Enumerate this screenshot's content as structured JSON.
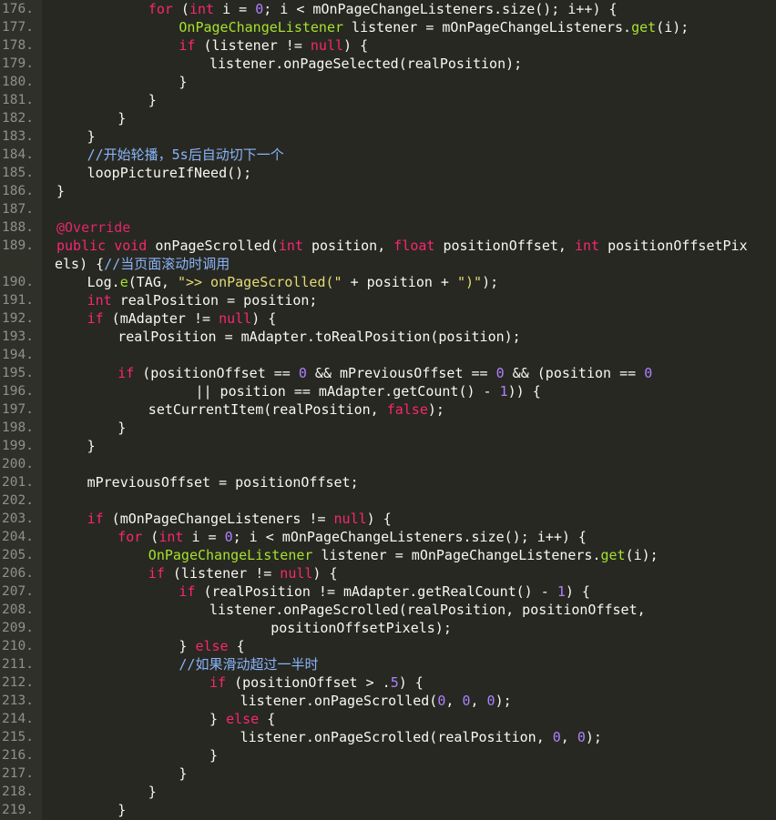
{
  "lines": [
    {
      "no": "176.",
      "ind": 7,
      "tok": [
        [
          "k",
          "for"
        ],
        [
          "p",
          " ("
        ],
        [
          "k",
          "int"
        ],
        [
          "p",
          " i = "
        ],
        [
          "n",
          "0"
        ],
        [
          "p",
          "; i < mOnPageChangeListeners.size(); i++) {"
        ]
      ]
    },
    {
      "no": "177.",
      "ind": 8,
      "tok": [
        [
          "f",
          "OnPageChangeListener"
        ],
        [
          "p",
          " listener = mOnPageChangeListeners."
        ],
        [
          "f",
          "get"
        ],
        [
          "p",
          "(i);"
        ]
      ]
    },
    {
      "no": "178.",
      "ind": 8,
      "tok": [
        [
          "k",
          "if"
        ],
        [
          "p",
          " (listener != "
        ],
        [
          "k",
          "null"
        ],
        [
          "p",
          ") {"
        ]
      ]
    },
    {
      "no": "179.",
      "ind": 9,
      "tok": [
        [
          "p",
          "listener.onPageSelected(realPosition);"
        ]
      ]
    },
    {
      "no": "180.",
      "ind": 8,
      "tok": [
        [
          "p",
          "}"
        ]
      ]
    },
    {
      "no": "181.",
      "ind": 7,
      "tok": [
        [
          "p",
          "}"
        ]
      ]
    },
    {
      "no": "182.",
      "ind": 6,
      "tok": [
        [
          "p",
          "}"
        ]
      ]
    },
    {
      "no": "183.",
      "ind": 5,
      "tok": [
        [
          "p",
          "}"
        ]
      ]
    },
    {
      "no": "184.",
      "ind": 5,
      "tok": [
        [
          "cm",
          "//开始轮播，5s后自动切下一个"
        ]
      ]
    },
    {
      "no": "185.",
      "ind": 5,
      "tok": [
        [
          "p",
          "loopPictureIfNeed();"
        ]
      ]
    },
    {
      "no": "186.",
      "ind": 4,
      "tok": [
        [
          "p",
          "}"
        ]
      ]
    },
    {
      "no": "187.",
      "ind": 0,
      "tok": []
    },
    {
      "no": "188.",
      "ind": 4,
      "tok": [
        [
          "a",
          "@Override"
        ]
      ]
    },
    {
      "no": "189.",
      "ind": 4,
      "tok": [
        [
          "k",
          "public"
        ],
        [
          "p",
          " "
        ],
        [
          "k",
          "void"
        ],
        [
          "p",
          " onPageScrolled("
        ],
        [
          "k",
          "int"
        ],
        [
          "p",
          " position, "
        ],
        [
          "k",
          "float"
        ],
        [
          "p",
          " positionOffset, "
        ],
        [
          "k",
          "int"
        ],
        [
          "p",
          " positionOffsetPix"
        ]
      ]
    },
    {
      "no": "",
      "ind": 0,
      "wrap": true,
      "tok": [
        [
          "p",
          "els) {"
        ],
        [
          "cm",
          "//当页面滚动时调用"
        ]
      ]
    },
    {
      "no": "190.",
      "ind": 5,
      "tok": [
        [
          "p",
          "Log."
        ],
        [
          "f",
          "e"
        ],
        [
          "p",
          "(TAG, "
        ],
        [
          "s",
          "\">> onPageScrolled(\""
        ],
        [
          "p",
          " + position + "
        ],
        [
          "s",
          "\")\""
        ],
        [
          "p",
          ");"
        ]
      ]
    },
    {
      "no": "191.",
      "ind": 5,
      "tok": [
        [
          "k",
          "int"
        ],
        [
          "p",
          " realPosition = position;"
        ]
      ]
    },
    {
      "no": "192.",
      "ind": 5,
      "tok": [
        [
          "k",
          "if"
        ],
        [
          "p",
          " (mAdapter != "
        ],
        [
          "k",
          "null"
        ],
        [
          "p",
          ") {"
        ]
      ]
    },
    {
      "no": "193.",
      "ind": 6,
      "tok": [
        [
          "p",
          "realPosition = mAdapter.toRealPosition(position);"
        ]
      ]
    },
    {
      "no": "194.",
      "ind": 0,
      "tok": []
    },
    {
      "no": "195.",
      "ind": 6,
      "tok": [
        [
          "k",
          "if"
        ],
        [
          "p",
          " (positionOffset == "
        ],
        [
          "n",
          "0"
        ],
        [
          "p",
          " && mPreviousOffset == "
        ],
        [
          "n",
          "0"
        ],
        [
          "p",
          " && (position == "
        ],
        [
          "n",
          "0"
        ]
      ]
    },
    {
      "no": "196.",
      "ind": 8,
      "extra": "  ",
      "tok": [
        [
          "p",
          "|| position == mAdapter.getCount() - "
        ],
        [
          "n",
          "1"
        ],
        [
          "p",
          ")) {"
        ]
      ]
    },
    {
      "no": "197.",
      "ind": 7,
      "tok": [
        [
          "p",
          "setCurrentItem(realPosition, "
        ],
        [
          "k",
          "false"
        ],
        [
          "p",
          ");"
        ]
      ]
    },
    {
      "no": "198.",
      "ind": 6,
      "tok": [
        [
          "p",
          "}"
        ]
      ]
    },
    {
      "no": "199.",
      "ind": 5,
      "tok": [
        [
          "p",
          "}"
        ]
      ]
    },
    {
      "no": "200.",
      "ind": 0,
      "tok": []
    },
    {
      "no": "201.",
      "ind": 5,
      "tok": [
        [
          "p",
          "mPreviousOffset = positionOffset;"
        ]
      ]
    },
    {
      "no": "202.",
      "ind": 0,
      "tok": []
    },
    {
      "no": "203.",
      "ind": 5,
      "tok": [
        [
          "k",
          "if"
        ],
        [
          "p",
          " (mOnPageChangeListeners != "
        ],
        [
          "k",
          "null"
        ],
        [
          "p",
          ") {"
        ]
      ]
    },
    {
      "no": "204.",
      "ind": 6,
      "tok": [
        [
          "k",
          "for"
        ],
        [
          "p",
          " ("
        ],
        [
          "k",
          "int"
        ],
        [
          "p",
          " i = "
        ],
        [
          "n",
          "0"
        ],
        [
          "p",
          "; i < mOnPageChangeListeners.size(); i++) {"
        ]
      ]
    },
    {
      "no": "205.",
      "ind": 7,
      "tok": [
        [
          "f",
          "OnPageChangeListener"
        ],
        [
          "p",
          " listener = mOnPageChangeListeners."
        ],
        [
          "f",
          "get"
        ],
        [
          "p",
          "(i);"
        ]
      ]
    },
    {
      "no": "206.",
      "ind": 7,
      "tok": [
        [
          "k",
          "if"
        ],
        [
          "p",
          " (listener != "
        ],
        [
          "k",
          "null"
        ],
        [
          "p",
          ") {"
        ]
      ]
    },
    {
      "no": "207.",
      "ind": 8,
      "tok": [
        [
          "k",
          "if"
        ],
        [
          "p",
          " (realPosition != mAdapter.getRealCount() - "
        ],
        [
          "n",
          "1"
        ],
        [
          "p",
          ") {"
        ]
      ]
    },
    {
      "no": "208.",
      "ind": 9,
      "tok": [
        [
          "p",
          "listener.onPageScrolled(realPosition, positionOffset,"
        ]
      ]
    },
    {
      "no": "209.",
      "ind": 11,
      "tok": [
        [
          "p",
          "positionOffsetPixels);"
        ]
      ]
    },
    {
      "no": "210.",
      "ind": 8,
      "tok": [
        [
          "p",
          "} "
        ],
        [
          "k",
          "else"
        ],
        [
          "p",
          " {"
        ]
      ]
    },
    {
      "no": "211.",
      "ind": 8,
      "tok": [
        [
          "cm",
          "//如果滑动超过一半时"
        ]
      ]
    },
    {
      "no": "212.",
      "ind": 9,
      "tok": [
        [
          "k",
          "if"
        ],
        [
          "p",
          " (positionOffset > ."
        ],
        [
          "n",
          "5"
        ],
        [
          "p",
          ") {"
        ]
      ]
    },
    {
      "no": "213.",
      "ind": 10,
      "tok": [
        [
          "p",
          "listener.onPageScrolled("
        ],
        [
          "n",
          "0"
        ],
        [
          "p",
          ", "
        ],
        [
          "n",
          "0"
        ],
        [
          "p",
          ", "
        ],
        [
          "n",
          "0"
        ],
        [
          "p",
          ");"
        ]
      ]
    },
    {
      "no": "214.",
      "ind": 9,
      "tok": [
        [
          "p",
          "} "
        ],
        [
          "k",
          "else"
        ],
        [
          "p",
          " {"
        ]
      ]
    },
    {
      "no": "215.",
      "ind": 10,
      "tok": [
        [
          "p",
          "listener.onPageScrolled(realPosition, "
        ],
        [
          "n",
          "0"
        ],
        [
          "p",
          ", "
        ],
        [
          "n",
          "0"
        ],
        [
          "p",
          ");"
        ]
      ]
    },
    {
      "no": "216.",
      "ind": 9,
      "tok": [
        [
          "p",
          "}"
        ]
      ]
    },
    {
      "no": "217.",
      "ind": 8,
      "tok": [
        [
          "p",
          "}"
        ]
      ]
    },
    {
      "no": "218.",
      "ind": 7,
      "tok": [
        [
          "p",
          "}"
        ]
      ]
    },
    {
      "no": "219.",
      "ind": 6,
      "tok": [
        [
          "p",
          "}"
        ]
      ]
    }
  ],
  "colors": {
    "background": "#272822",
    "gutter": "#2f3129",
    "line_number": "#8f908a",
    "plain": "#f8f8f2",
    "keyword": "#f92672",
    "type_or_function": "#a6e22e",
    "number": "#ae81ff",
    "string": "#e6db74",
    "comment": "#8ab4f8"
  }
}
